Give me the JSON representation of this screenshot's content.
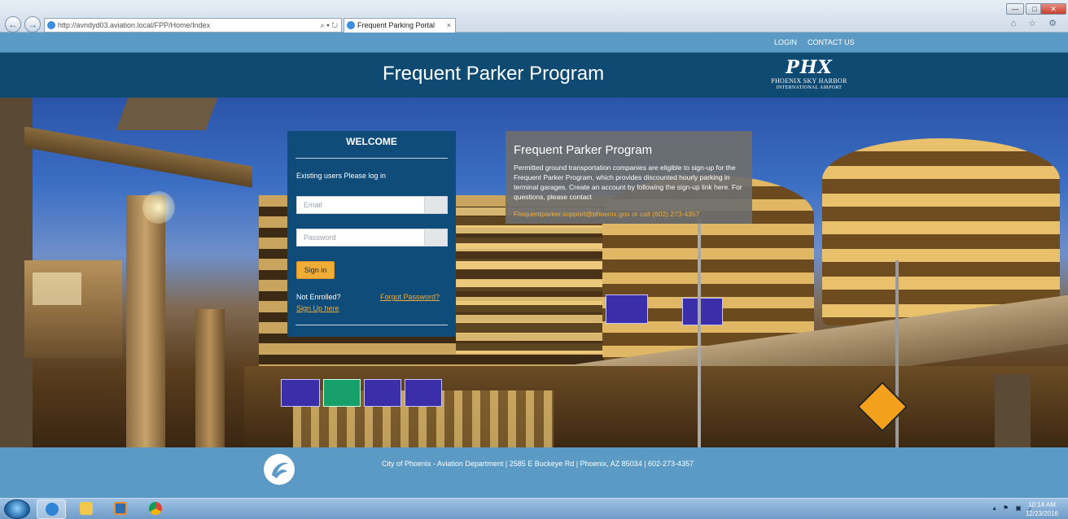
{
  "browser": {
    "url": "http://avndyd03.aviation.local/FPP/Home/Index",
    "search_tools": "⌕ ▾ ↻",
    "tab_title": "Frequent Parking Portal",
    "tab_close": "×",
    "back_glyph": "←",
    "forward_glyph": "→",
    "minimize": "—",
    "maximize": "□",
    "close": "✕",
    "right_icons": "⌂ ☆ ⚙"
  },
  "utility_nav": {
    "login": "LOGIN",
    "contact": "CONTACT US"
  },
  "header": {
    "title": "Frequent Parker Program",
    "logo_mark": "PHX",
    "logo_line1": "PHOENIX SKY HARBOR",
    "logo_line2": "INTERNATIONAL AIRPORT"
  },
  "login_card": {
    "title": "WELCOME",
    "subtitle": "Existing users Please log in",
    "email_placeholder": "Email",
    "password_placeholder": "Password",
    "signin_label": "Sign in",
    "not_enrolled": "Not Enrolled?",
    "signup_link": "Sign Up here",
    "forgot_link": "Forgot Password?"
  },
  "info_panel": {
    "title": "Frequent Parker Program",
    "body": "Permitted ground transportation companies are eligible to sign-up for the Frequent Parker Program, which provides discounted hourly parking in terminal garages. Create an account by following the sign-up link here. For questions, please contact",
    "contact": "Frequentparker.support@phoenix.gov  or call (602) 273-4357"
  },
  "footer": {
    "text": "City of Phoenix - Aviation Department | 2585 E Buckeye Rd | Phoenix, AZ 85034 | 602-273-4357"
  },
  "taskbar": {
    "tray_icons": "▴ ⚑ ▣ ♪",
    "time": "10:14 AM",
    "date": "12/23/2016"
  },
  "colors": {
    "header_bg": "#0e4a72",
    "utility_bg": "#5b9ac4",
    "card_bg": "#0f4c7a",
    "accent": "#f0ad35",
    "info_bg": "#6e6e6e"
  }
}
